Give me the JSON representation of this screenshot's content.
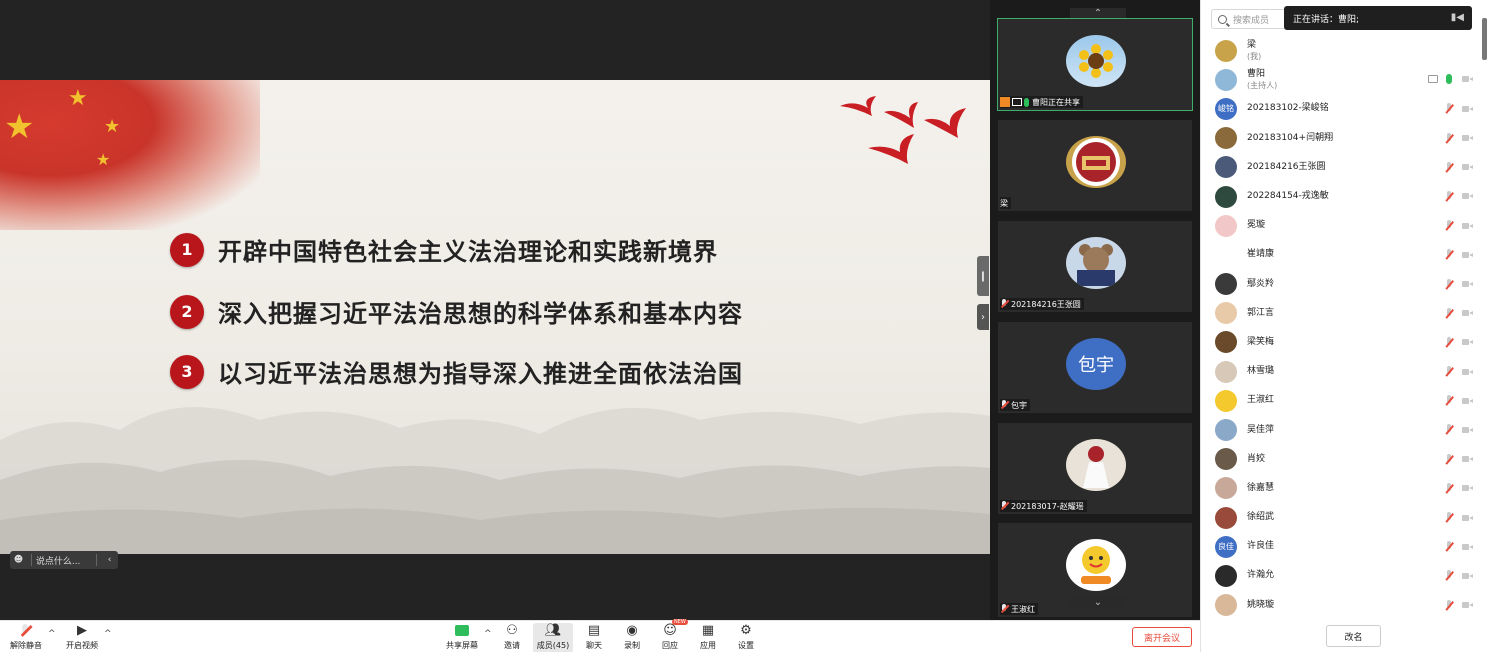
{
  "slide": {
    "items": [
      {
        "num": "1",
        "text": "开辟中国特色社会主义法治理论和实践新境界"
      },
      {
        "num": "2",
        "text": "深入把握习近平法治思想的科学体系和基本内容"
      },
      {
        "num": "3",
        "text": "以习近平法治思想为指导深入推进全面依法治国"
      }
    ]
  },
  "chat_bar": {
    "placeholder": "说点什么..."
  },
  "thumbnails": [
    {
      "label": "曹阳正在共享",
      "avatar": "sunflower-avatar"
    },
    {
      "label": "梁",
      "avatar": "school-emblem-avatar"
    },
    {
      "label": "202184216王张圆",
      "avatar": "teddy-bear-avatar"
    },
    {
      "label": "包宇",
      "avatar_text": "包宇"
    },
    {
      "label": "202183017-赵耀瑶",
      "avatar": "photo-avatar"
    },
    {
      "label": "王淑红",
      "avatar": "cartoon-sun-avatar"
    }
  ],
  "speaking": {
    "text": "正在讲话：曹阳;"
  },
  "search": {
    "placeholder": "搜索成员"
  },
  "participants": [
    {
      "name": "梁",
      "sub": "(我)",
      "avatar_color": "#c9a34a",
      "icons": "none"
    },
    {
      "name": "曹阳",
      "sub": "(主持人)",
      "avatar_color": "#8fb8d8",
      "icons": "host"
    },
    {
      "name": "202183102-梁峻铭",
      "avatar_text": "峻铭",
      "avatar_color": "#3f6fc4",
      "icons": "muted"
    },
    {
      "name": "202183104+闫朝翔",
      "avatar_color": "#8a6a3a",
      "icons": "muted"
    },
    {
      "name": "202184216王张圆",
      "avatar_color": "#4a5a78",
      "icons": "muted"
    },
    {
      "name": "202284154-戎逸敏",
      "avatar_color": "#2e4a3e",
      "icons": "muted"
    },
    {
      "name": "冕璇",
      "avatar_color": "#f2c7c7",
      "icons": "muted"
    },
    {
      "name": "崔靖康",
      "avatar_color": "#ffffff",
      "icons": "muted"
    },
    {
      "name": "鄢炎羚",
      "avatar_color": "#3a3a3a",
      "icons": "muted"
    },
    {
      "name": "郭江言",
      "avatar_color": "#e8c9a8",
      "icons": "muted"
    },
    {
      "name": "梁笑梅",
      "avatar_color": "#6a4a2a",
      "icons": "muted"
    },
    {
      "name": "林雪璐",
      "avatar_color": "#d8c8b8",
      "icons": "muted"
    },
    {
      "name": "王淑红",
      "avatar_color": "#f4c92e",
      "icons": "muted"
    },
    {
      "name": "吴佳萍",
      "avatar_color": "#8aa8c8",
      "icons": "muted"
    },
    {
      "name": "肖姣",
      "avatar_color": "#6a5a4a",
      "icons": "muted"
    },
    {
      "name": "徐嘉慧",
      "avatar_color": "#c8a898",
      "icons": "muted"
    },
    {
      "name": "徐绍武",
      "avatar_color": "#9a4a3a",
      "icons": "muted"
    },
    {
      "name": "许良佳",
      "avatar_text": "良佳",
      "avatar_color": "#3f6fc4",
      "icons": "muted"
    },
    {
      "name": "许瀚允",
      "avatar_color": "#2a2a2a",
      "icons": "muted"
    },
    {
      "name": "姚晓璇",
      "avatar_color": "#d8b898",
      "icons": "muted"
    }
  ],
  "rename_label": "改名",
  "toolbar": {
    "unmute": "解除静音",
    "start_video": "开启视频",
    "share_screen": "共享屏幕",
    "invite": "邀请",
    "members": "成员(45)",
    "chat": "聊天",
    "record": "录制",
    "reaction": "回应",
    "reaction_badge": "NEW",
    "apps": "应用",
    "settings": "设置",
    "leave": "离开会议"
  }
}
